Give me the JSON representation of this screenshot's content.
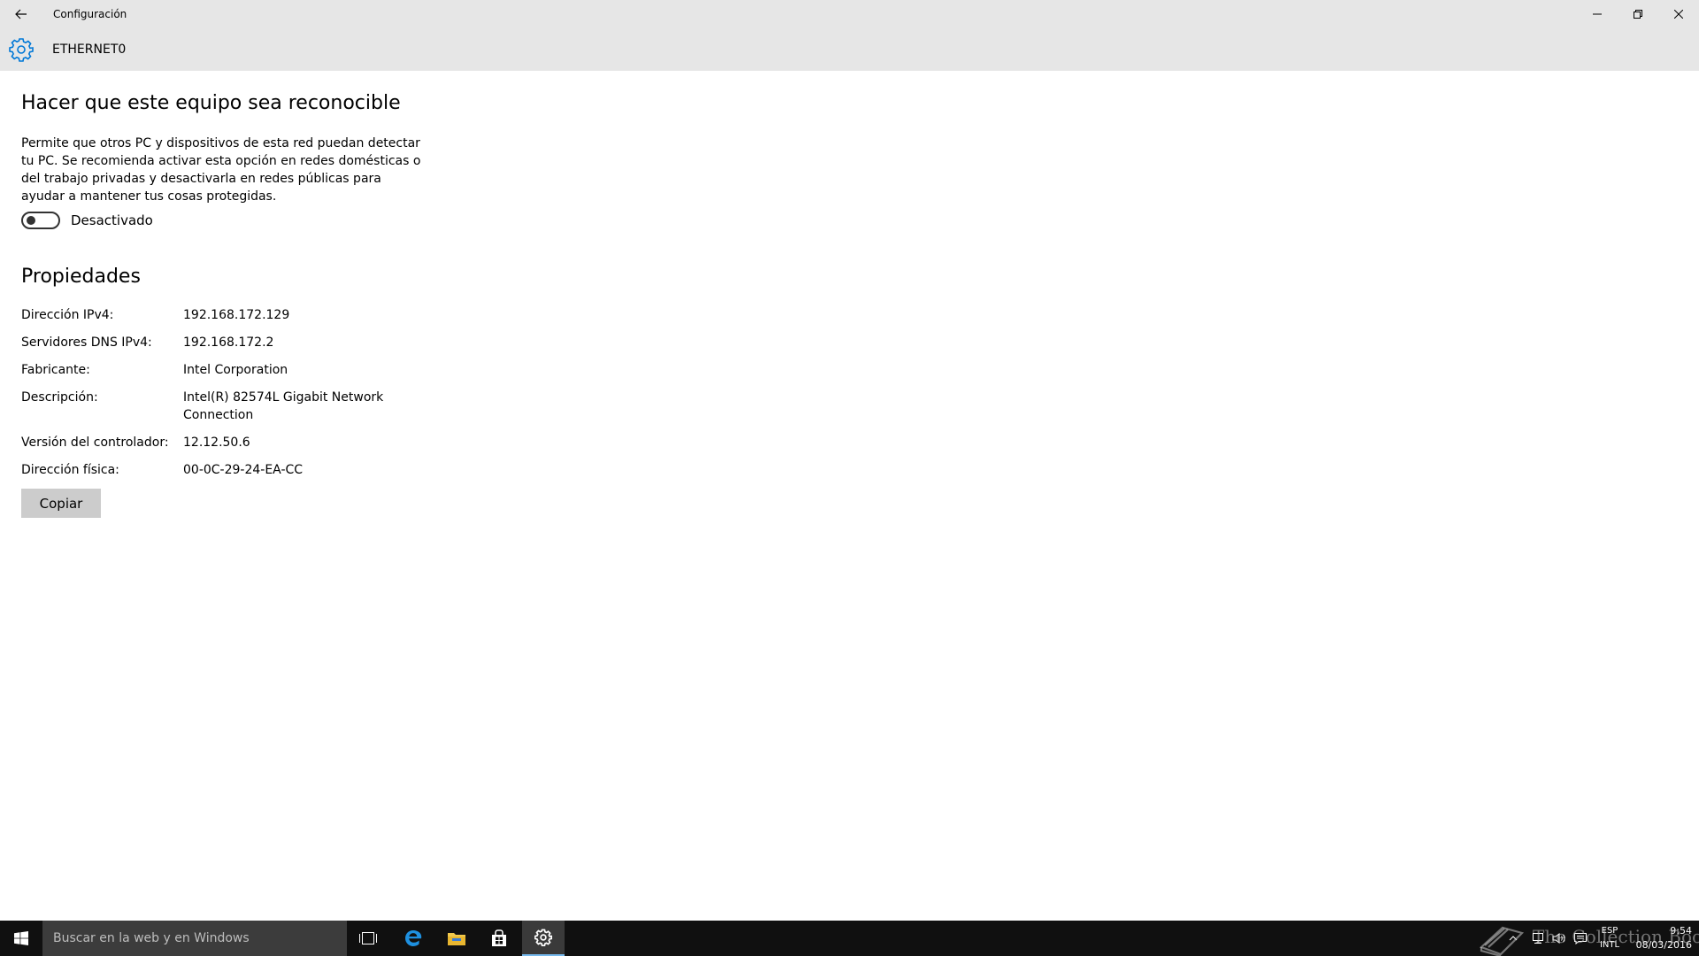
{
  "window": {
    "app_title": "Configuración",
    "back_icon": "back-arrow-icon",
    "minimize_icon": "minimize-icon",
    "maximize_icon": "restore-icon",
    "close_icon": "close-icon"
  },
  "header": {
    "icon": "gear-icon",
    "title": "ETHERNET0",
    "accent_color": "#0078d7"
  },
  "discovery": {
    "title": "Hacer que este equipo sea reconocible",
    "description": "Permite que otros PC y dispositivos de esta red puedan detectar tu PC. Se recomienda activar esta opción en redes domésticas o del trabajo privadas y desactivarla en redes públicas para ayudar a mantener tus cosas protegidas.",
    "toggle_state": "off",
    "toggle_label": "Desactivado"
  },
  "properties": {
    "title": "Propiedades",
    "rows": [
      {
        "key": "Dirección IPv4:",
        "value": "192.168.172.129"
      },
      {
        "key": "Servidores DNS IPv4:",
        "value": "192.168.172.2"
      },
      {
        "key": "Fabricante:",
        "value": "Intel Corporation"
      },
      {
        "key": "Descripción:",
        "value": "Intel(R) 82574L Gigabit Network Connection"
      },
      {
        "key": "Versión del controlador:",
        "value": "12.12.50.6"
      },
      {
        "key": "Dirección física:",
        "value": "00-0C-29-24-EA-CC"
      }
    ],
    "copy_label": "Copiar"
  },
  "taskbar": {
    "search_placeholder": "Buscar en la web y en Windows",
    "pinned": [
      "task-view-icon",
      "edge-icon",
      "file-explorer-icon",
      "store-icon",
      "settings-gear-icon"
    ],
    "active": "settings-gear-icon",
    "watermark": "The Collection Book",
    "tray_icons": [
      "chevron-up-icon",
      "network-icon",
      "volume-icon",
      "notifications-icon"
    ],
    "language_top": "ESP",
    "language_bottom": "INTL",
    "time": "9:54",
    "date": "08/03/2016"
  }
}
